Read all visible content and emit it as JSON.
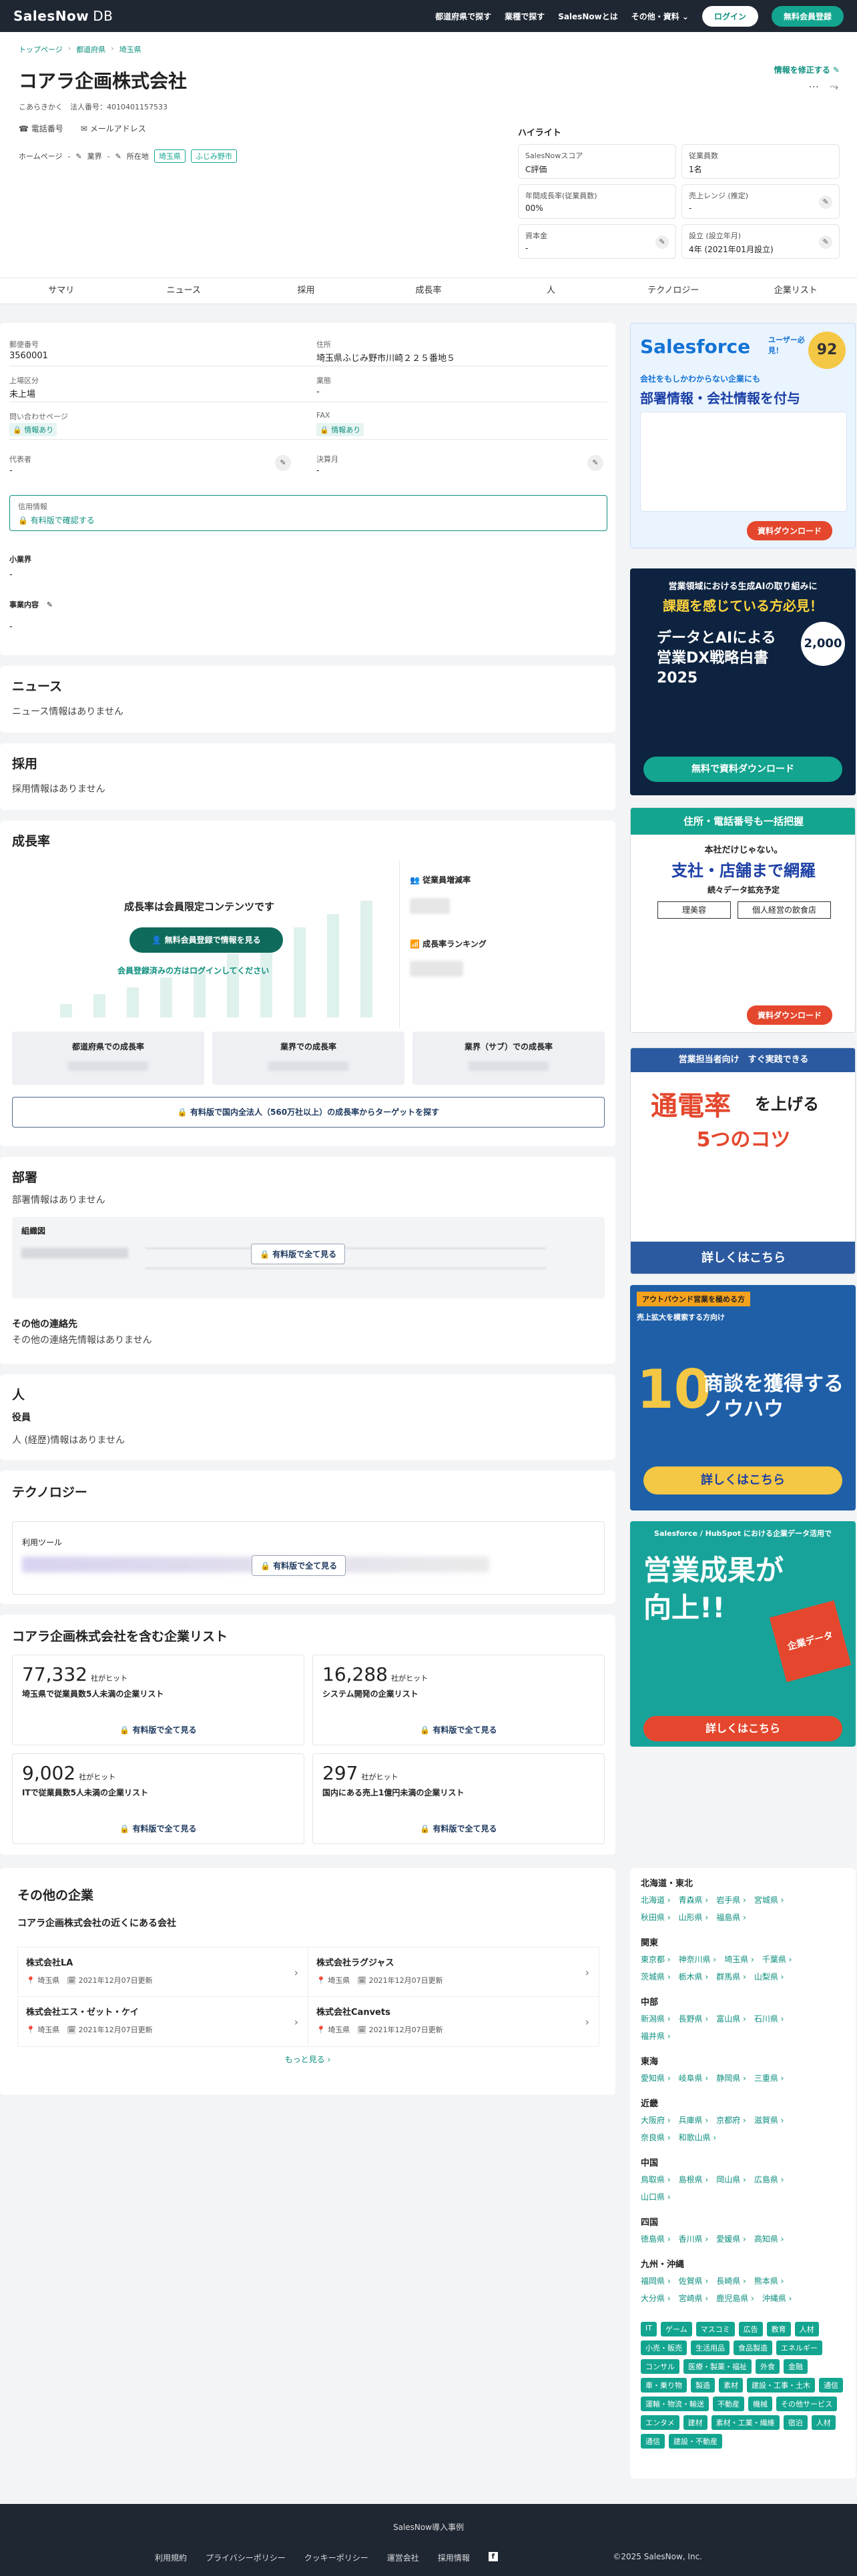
{
  "header": {
    "logo": "SalesNow",
    "logo_db": "DB",
    "nav": [
      "都道府県で探す",
      "業種で探す",
      "SalesNowとは",
      "その他・資料"
    ],
    "login": "ログイン",
    "register": "無料会員登録"
  },
  "breadcrumb": [
    "トップページ",
    "都道府県",
    "埼玉県"
  ],
  "company": {
    "name": "コアラ企画株式会社",
    "kana": "こあらきかく",
    "corp_no_label": "法人番号：4010401157533",
    "phone": "電話番号",
    "mail": "メールアドレス",
    "homepage": "ホームページ",
    "homepage_val": "-",
    "industry": "業界",
    "industry_val": "-",
    "location_label": "所在地",
    "loc1": "埼玉県",
    "loc2": "ふじみ野市",
    "edit": "情報を修正する"
  },
  "highlight": {
    "title": "ハイライト",
    "cards": [
      {
        "t": "SalesNowスコア",
        "v": "C評価"
      },
      {
        "t": "従業員数",
        "v": "1名"
      },
      {
        "t": "年間成長率(従業員数)",
        "v": "00%"
      },
      {
        "t": "売上レンジ (推定)",
        "v": "-"
      },
      {
        "t": "資本金",
        "v": "-"
      },
      {
        "t": "設立 (設立年月)",
        "v": "4年 (2021年01月設立)"
      }
    ]
  },
  "tabs": [
    "サマリ",
    "ニュース",
    "採用",
    "成長率",
    "人",
    "テクノロジー",
    "企業リスト"
  ],
  "summary": {
    "zip_l": "郵便番号",
    "zip": "3560001",
    "addr_l": "住所",
    "addr": "埼玉県ふじみ野市川崎２２５番地５",
    "listed_l": "上場区分",
    "listed": "未上場",
    "ind_l": "業態",
    "ind": "-",
    "inq_l": "問い合わせページ",
    "inq": "情報あり",
    "fax_l": "FAX",
    "fax": "情報あり",
    "rep_l": "代表者",
    "rep": "-",
    "fiscal_l": "決算月",
    "fiscal": "-",
    "credit_l": "信用情報",
    "credit": "有料版で確認する",
    "sub_l": "小業界",
    "sub": "-",
    "biz_l": "事業内容",
    "biz": "-"
  },
  "news": {
    "title": "ニュース",
    "empty": "ニュース情報はありません"
  },
  "recruit": {
    "title": "採用",
    "empty": "採用情報はありません"
  },
  "growth": {
    "title": "成長率",
    "locked": "成長率は会員限定コンテンツです",
    "cta": "無料会員登録で情報を見る",
    "login": "会員登録済みの方はログインしてください",
    "emp": "従業員増減率",
    "rank": "成長率ランキング",
    "boxes": [
      "都道府県での成長率",
      "業界での成長率",
      "業界（サブ）での成長率"
    ],
    "paid": "有料版で国内全法人（560万社以上）の成長率からターゲットを探す"
  },
  "dept": {
    "title": "部署",
    "empty": "部署情報はありません",
    "org": "組織図",
    "paid": "有料版で全て見る",
    "other": "その他の連絡先",
    "other_empty": "その他の連絡先情報はありません"
  },
  "people": {
    "title": "人",
    "sub": "役員",
    "empty": "人 (経歴)情報はありません"
  },
  "tech": {
    "title": "テクノロジー",
    "tools": "利用ツール",
    "paid": "有料版で全て見る"
  },
  "lists": {
    "title": "コアラ企画株式会社を含む企業リスト",
    "unit": "社がヒット",
    "paid": "有料版で全て見る",
    "items": [
      {
        "n": "77,332",
        "d": "埼玉県で従業員数5人未満の企業リスト"
      },
      {
        "n": "16,288",
        "d": "システム開発の企業リスト"
      },
      {
        "n": "9,002",
        "d": "ITで従業員数5人未満の企業リスト"
      },
      {
        "n": "297",
        "d": "国内にある売上1億円未満の企業リスト"
      }
    ]
  },
  "others": {
    "title": "その他の企業",
    "sub": "コアラ企画株式会社の近くにある会社",
    "more": "もっと見る",
    "items": [
      {
        "n": "株式会社LA",
        "p": "埼玉県",
        "d": "2021年12月07日更新"
      },
      {
        "n": "株式会社ラグジャス",
        "p": "埼玉県",
        "d": "2021年12月07日更新"
      },
      {
        "n": "株式会社エス・ゼット・ケイ",
        "p": "埼玉県",
        "d": "2021年12月07日更新"
      },
      {
        "n": "株式会社Canvets",
        "p": "埼玉県",
        "d": "2021年12月07日更新"
      }
    ]
  },
  "ads": {
    "a1_t": "Salesforce",
    "a1_s": "ユーザー必見！",
    "a1_b": "会社をもしかわからない企業にも",
    "a1_h": "部署情報・会社情報を付与",
    "a1_btn": "資料ダウンロード",
    "a2_t": "営業領域における生成AIの取り組みに",
    "a2_h": "課題を感じている方必見！",
    "a2_b": "データとAIによる営業DX戦略白書2025",
    "a2_btn": "無料で資料ダウンロード",
    "a3_t": "住所・電話番号も一括把握",
    "a3_s": "本社だけじゃない。",
    "a3_h": "支社・店舗まで網羅",
    "a3_b": "続々データ拡充予定",
    "a3_c1": "理美容",
    "a3_c2": "個人経営の飲食店",
    "a3_btn": "資料ダウンロード",
    "a4_t": "営業担当者向け　すぐ実践できる",
    "a4_h1": "通電率",
    "a4_h2": "を上げる",
    "a4_h3": "5つのコツ",
    "a4_btn": "詳しくはこちら",
    "a5_t": "アウトバウンド営業を極める方",
    "a5_s": "売上拡大を模索する方向け",
    "a5_n": "10",
    "a5_h": "商談を獲得するノウハウ",
    "a5_btn": "詳しくはこちら",
    "a6_t": "Salesforce / HubSpot における企業データ活用で",
    "a6_h1": "営業成果が",
    "a6_h2": "向上!!",
    "a6_p": "企業データ",
    "a6_btn": "詳しくはこちら",
    "score": "92"
  },
  "regions": [
    {
      "h": "北海道・東北",
      "rows": [
        "北海道 ›　青森県 ›　岩手県 ›　宮城県 ›",
        "秋田県 ›　山形県 ›　福島県 ›"
      ]
    },
    {
      "h": "関東",
      "rows": [
        "東京都 ›　神奈川県 ›　埼玉県 ›　千葉県 ›",
        "茨城県 ›　栃木県 ›　群馬県 ›　山梨県 ›"
      ]
    },
    {
      "h": "中部",
      "rows": [
        "新潟県 ›　長野県 ›　富山県 ›　石川県 ›",
        "福井県 ›"
      ]
    },
    {
      "h": "東海",
      "rows": [
        "愛知県 ›　岐阜県 ›　静岡県 ›　三重県 ›"
      ]
    },
    {
      "h": "近畿",
      "rows": [
        "大阪府 ›　兵庫県 ›　京都府 ›　滋賀県 ›",
        "奈良県 ›　和歌山県 ›"
      ]
    },
    {
      "h": "中国",
      "rows": [
        "鳥取県 ›　島根県 ›　岡山県 ›　広島県 ›",
        "山口県 ›"
      ]
    },
    {
      "h": "四国",
      "rows": [
        "徳島県 ›　香川県 ›　愛媛県 ›　高知県 ›"
      ]
    },
    {
      "h": "九州・沖縄",
      "rows": [
        "福岡県 ›　佐賀県 ›　長崎県 ›　熊本県 ›",
        "大分県 ›　宮崎県 ›　鹿児島県 ›　沖縄県 ›"
      ]
    }
  ],
  "industries": [
    "IT",
    "ゲーム",
    "マスコミ",
    "広告",
    "教育",
    "人材",
    "小売・販売",
    "生活用品",
    "食品製造",
    "エネルギー",
    "コンサル",
    "医療・製薬・福祉",
    "外食",
    "金融",
    "車・乗り物",
    "製造",
    "素材",
    "建設・工事・土木",
    "通信",
    "運輸・物流・輸送",
    "不動産",
    "機械",
    "その他サービス",
    "エンタメ",
    "建材",
    "素材・工業・繊維",
    "宿泊",
    "人材",
    "通信",
    "建設・不動産"
  ],
  "footer": {
    "top": "SalesNow導入事例",
    "links": [
      "利用規約",
      "プライバシーポリシー",
      "クッキーポリシー",
      "運営会社",
      "採用情報"
    ],
    "copy": "©2025 SalesNow, Inc."
  }
}
